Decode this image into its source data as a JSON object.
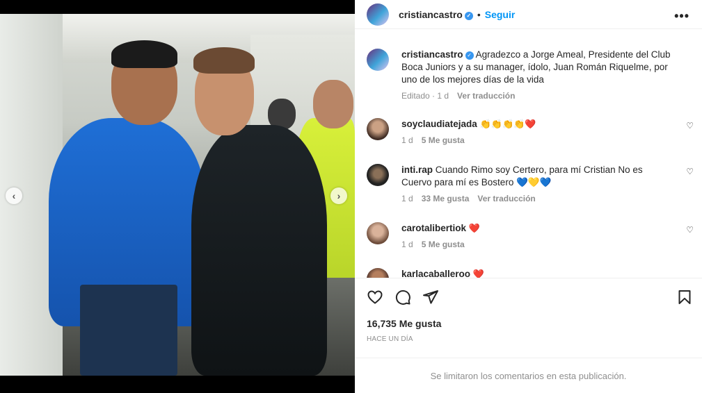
{
  "post": {
    "author": "cristiancastro",
    "follow_label": "Seguir",
    "more_icon": "more-icon",
    "caption": "Agradezco a Jorge Ameal, Presidente del Club Boca Juniors y a su manager, ídolo, Juan Román Riquelme, por uno de los mejores días de la vida",
    "edited_label": "Editado · 1 d",
    "translate_label": "Ver traducción"
  },
  "comments": [
    {
      "user": "soyclaudiatejada",
      "text": "👏👏👏👏❤️",
      "time": "1 d",
      "likes": "5 Me gusta",
      "translate": ""
    },
    {
      "user": "inti.rap",
      "text": "Cuando Rimo soy Certero, para mí Cristian No es Cuervo para mí es Bostero 💙💛💙",
      "time": "1 d",
      "likes": "33 Me gusta",
      "translate": "Ver traducción"
    },
    {
      "user": "carotalibertiok",
      "text": "❤️",
      "time": "1 d",
      "likes": "5 Me gusta",
      "translate": ""
    },
    {
      "user": "karlacaballeroo",
      "text": "❤️",
      "time": "",
      "likes": "",
      "translate": ""
    }
  ],
  "engagement": {
    "likes": "16,735 Me gusta",
    "date": "HACE UN DÍA",
    "comments_limited": "Se limitaron los comentarios en esta publicación."
  },
  "carousel": {
    "prev_label": "‹",
    "next_label": "›",
    "slides": 3,
    "active": 2
  },
  "colors": {
    "accent": "#0095f6",
    "verified": "#3897f0",
    "text": "#262626",
    "muted": "#8e8e8e"
  }
}
